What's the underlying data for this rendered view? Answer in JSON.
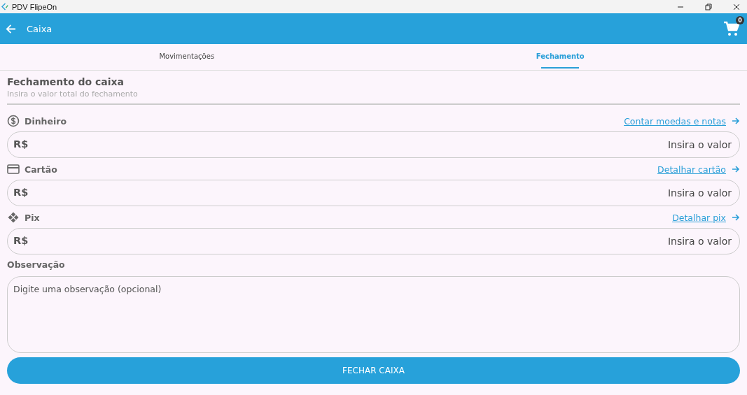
{
  "window": {
    "title": "PDV FlipeOn"
  },
  "app_bar": {
    "title": "Caixa",
    "cart_count": "0"
  },
  "tabs": [
    {
      "label": "Movimentações",
      "selected": false
    },
    {
      "label": "Fechamento",
      "selected": true
    }
  ],
  "section": {
    "title": "Fechamento do caixa",
    "subtitle": "Insira o valor total do fechamento"
  },
  "payments": [
    {
      "kind": "cash",
      "label": "Dinheiro",
      "link": "Contar moedas e notas",
      "prefix": "R$",
      "placeholder": "Insira o valor"
    },
    {
      "kind": "card",
      "label": "Cartão",
      "link": "Detalhar cartão",
      "prefix": "R$",
      "placeholder": "Insira o valor"
    },
    {
      "kind": "pix",
      "label": "Pix",
      "link": "Detalhar pix",
      "prefix": "R$",
      "placeholder": "Insira o valor"
    }
  ],
  "note": {
    "label": "Observação",
    "placeholder": "Digite uma observação (opcional)"
  },
  "submit_button": "FECHAR CAIXA"
}
